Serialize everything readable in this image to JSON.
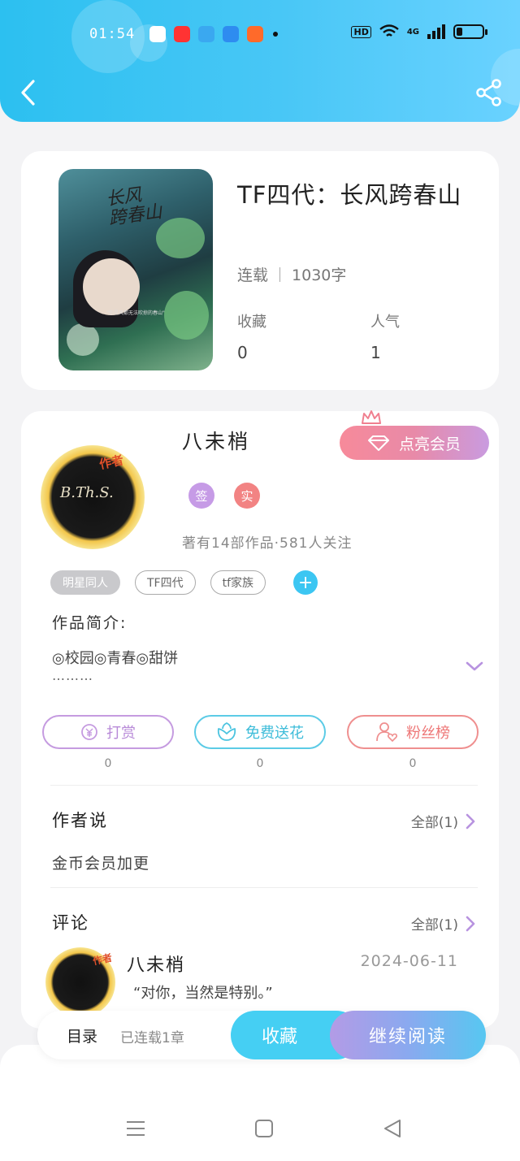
{
  "status_bar": {
    "time": "01:54",
    "network": "4G",
    "hd": "HD"
  },
  "book": {
    "cover_title": "长风\n跨春山",
    "cover_quote": "\"你是风都无法吹掠的春山\"",
    "title": "TF四代：长风跨春山",
    "status": "连载",
    "words": "1030字",
    "stats": [
      {
        "label": "收藏",
        "value": "0"
      },
      {
        "label": "人气",
        "value": "1"
      }
    ]
  },
  "author": {
    "name": "八未梢",
    "avatar_tag": "作者",
    "avatar_initials": "B.Th.S.",
    "vip_button": "点亮会员",
    "badges": [
      "签",
      "实"
    ],
    "works_info": "著有14部作品·581人关注",
    "tags": [
      "明星同人",
      "TF四代",
      "tf家族"
    ]
  },
  "intro": {
    "label": "作品简介:",
    "text": "◎校园◎青春◎甜饼",
    "more": "………"
  },
  "actions": [
    {
      "label": "打赏",
      "count": "0",
      "color": "#c59be0"
    },
    {
      "label": "免费送花",
      "count": "0",
      "color": "#5ccbe6"
    },
    {
      "label": "粉丝榜",
      "count": "0",
      "color": "#ef8f8f"
    }
  ],
  "author_says": {
    "title": "作者说",
    "all": "全部(1)",
    "text": "金币会员加更"
  },
  "comments": {
    "title": "评论",
    "all": "全部(1)",
    "items": [
      {
        "user": "八未梢",
        "tag": "作者",
        "date": "2024-06-11",
        "text": "“对你，当然是特别。”"
      }
    ]
  },
  "bottom_bar": {
    "toc": "目录",
    "toc_sub": "已连载1章",
    "favorite": "收藏",
    "continue": "继续阅读"
  },
  "colors": {
    "header": "#2cc0f0",
    "accent": "#45cff3",
    "vip": "#f78a9a",
    "badge_sign": "#c69be6",
    "badge_real": "#f28383"
  }
}
